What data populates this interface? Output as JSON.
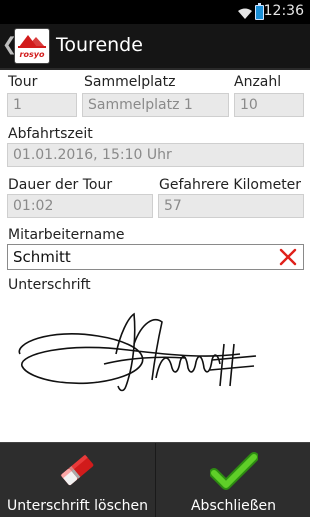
{
  "status": {
    "time": "12:36"
  },
  "header": {
    "title": "Tourende",
    "logo_text": "rosyo"
  },
  "fields": {
    "tour": {
      "label": "Tour",
      "value": "1"
    },
    "sammelplatz": {
      "label": "Sammelplatz",
      "value": "Sammelplatz 1"
    },
    "anzahl": {
      "label": "Anzahl",
      "value": "10"
    },
    "abfahrtszeit": {
      "label": "Abfahrtszeit",
      "value": "01.01.2016, 15:10 Uhr"
    },
    "dauer": {
      "label": "Dauer der Tour",
      "value": "01:02"
    },
    "kilometer": {
      "label": "Gefahrere Kilometer",
      "value": "57"
    },
    "mitarbeiter": {
      "label": "Mitarbeitername",
      "value": "Schmitt"
    },
    "unterschrift": {
      "label": "Unterschrift"
    }
  },
  "actions": {
    "clear_signature": "Unterschrift löschen",
    "finish": "Abschließen"
  },
  "colors": {
    "clear_x": "#e0201a",
    "check": "#4dbb1f",
    "eraser": "#d11b1b"
  },
  "icons": {
    "clear": "close-icon",
    "eraser": "eraser-icon",
    "check": "check-icon"
  }
}
